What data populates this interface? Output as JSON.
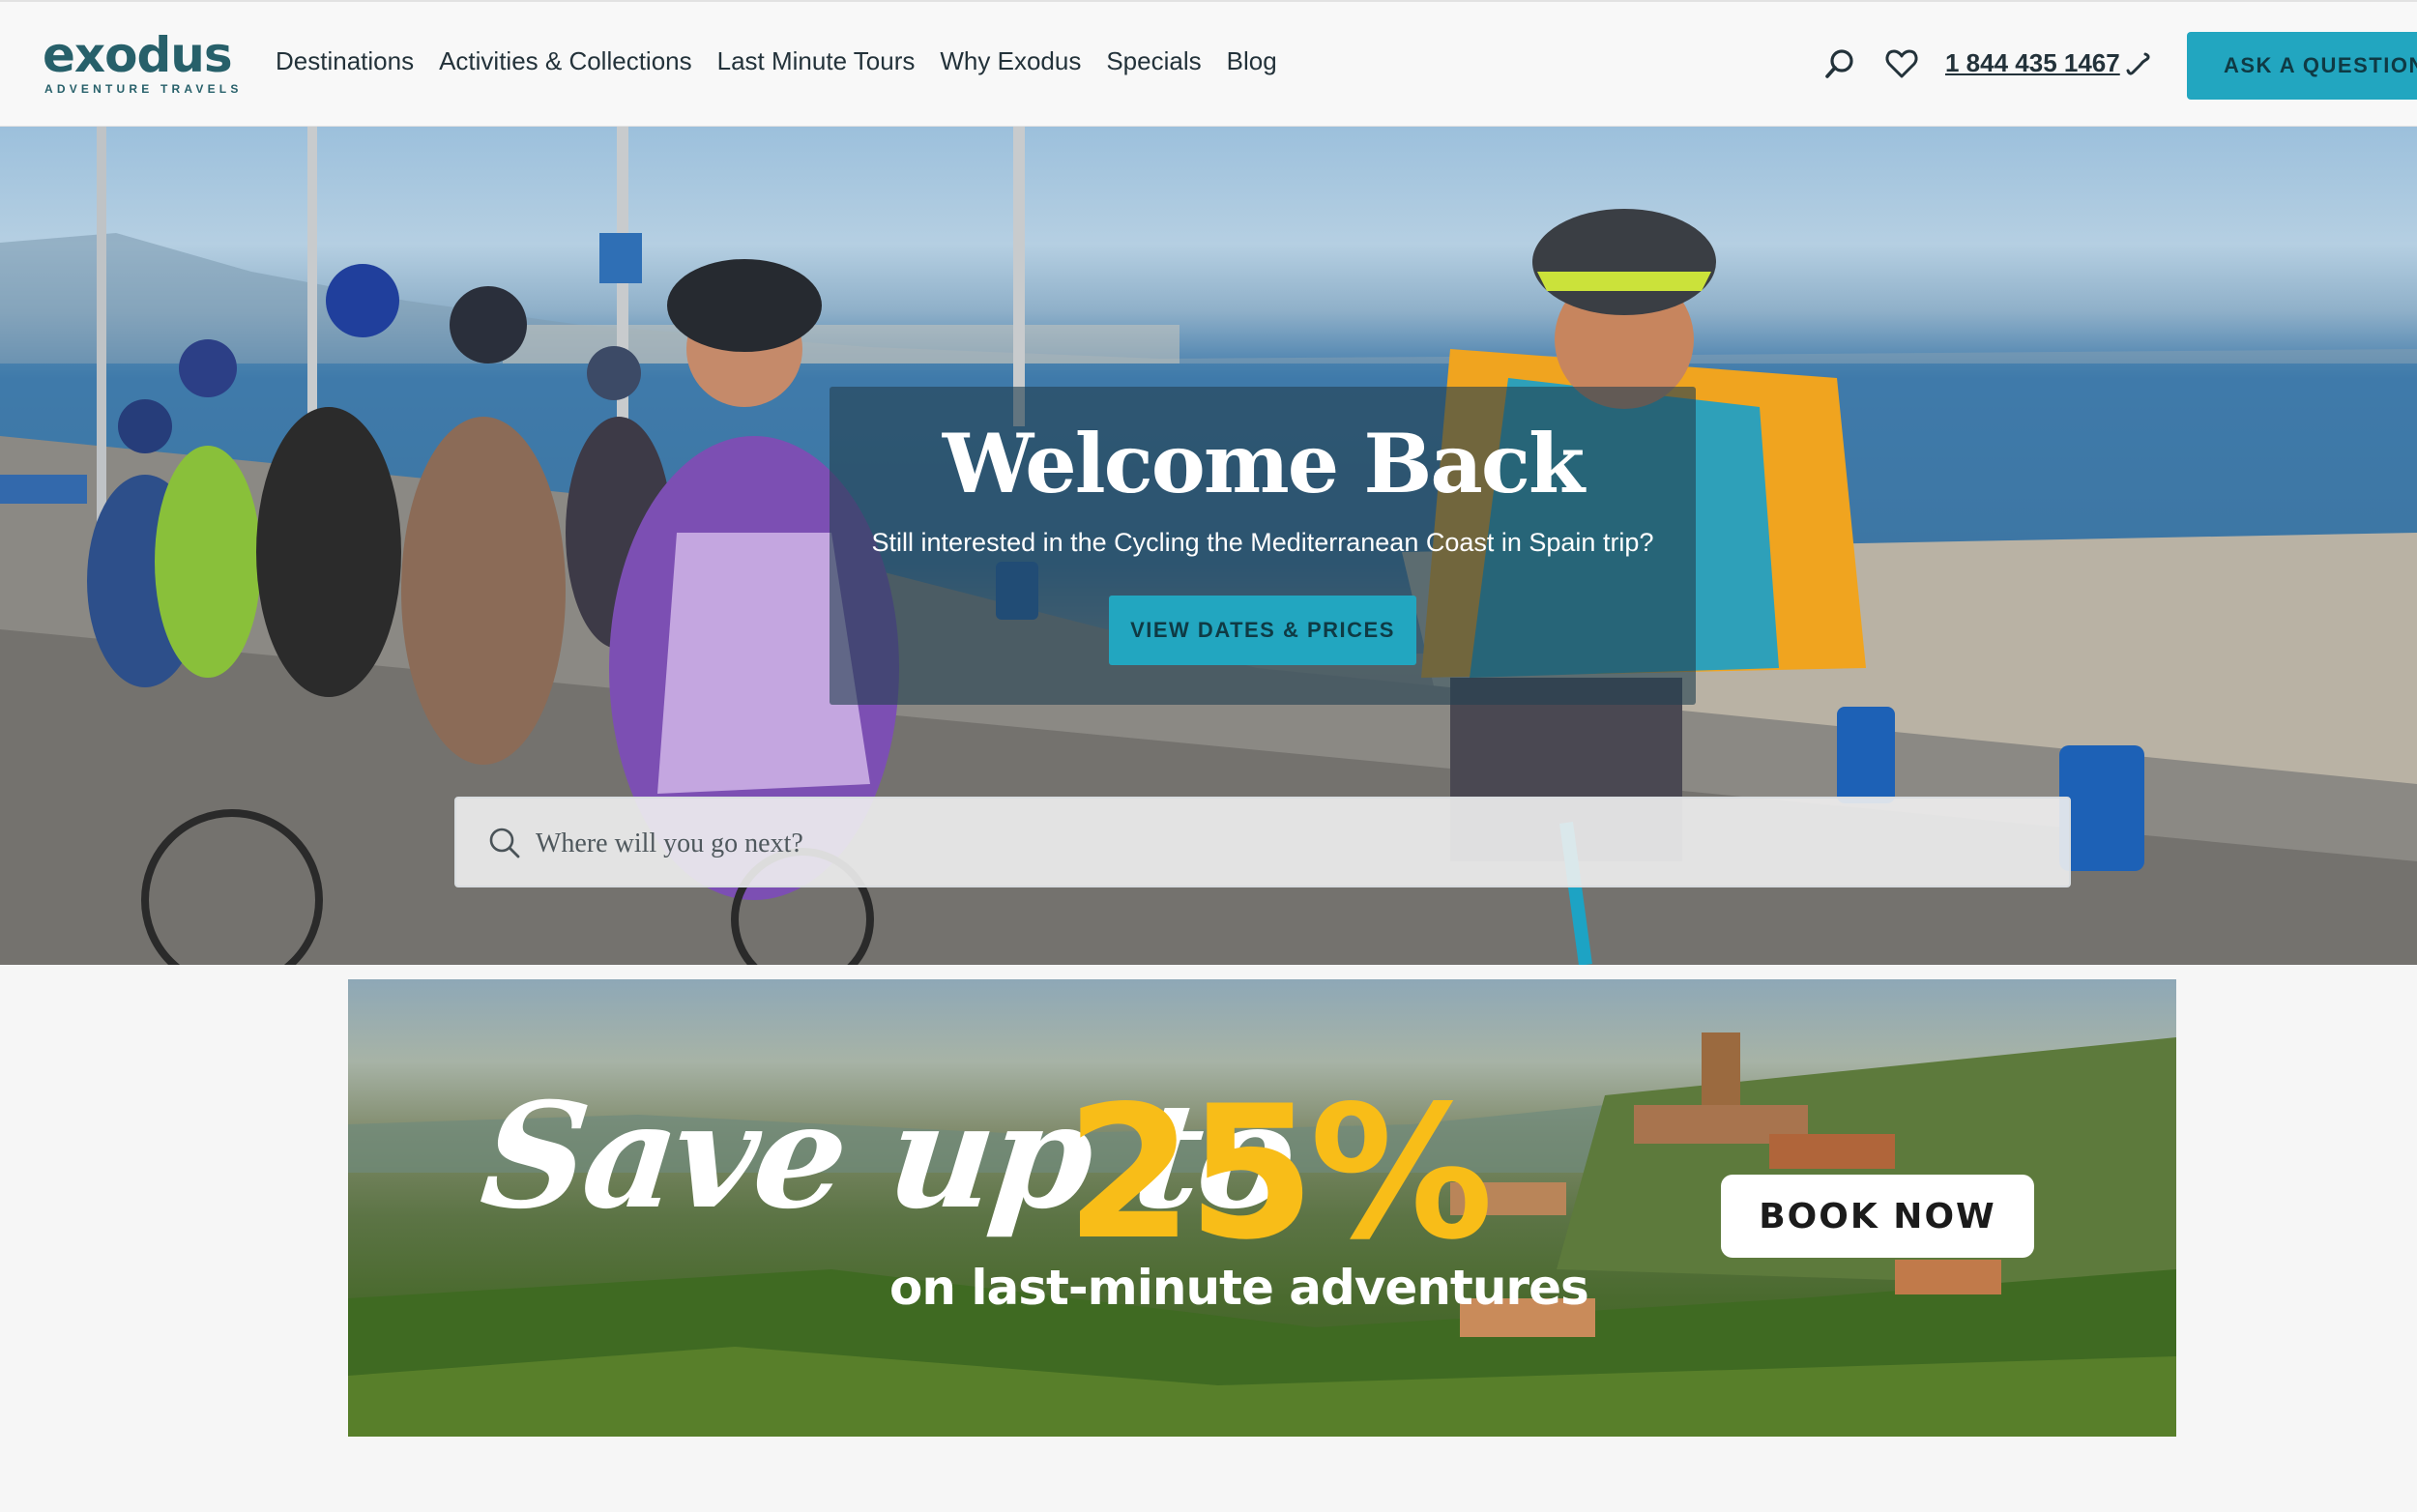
{
  "brand": {
    "name": "exodus",
    "tagline": "ADVENTURE TRAVELS",
    "color": "#27606a",
    "accent": "#22a6c0"
  },
  "nav": [
    {
      "label": "Destinations"
    },
    {
      "label": "Activities & Collections"
    },
    {
      "label": "Last Minute Tours"
    },
    {
      "label": "Why Exodus"
    },
    {
      "label": "Specials"
    },
    {
      "label": "Blog"
    }
  ],
  "header": {
    "search_icon": "search-icon",
    "wishlist_icon": "heart-icon",
    "phone": "1 844 435 1467",
    "phone_icon": "phone-icon",
    "ask_label": "ASK A QUESTION"
  },
  "hero": {
    "title": "Welcome Back",
    "subtitle": "Still interested in the Cycling the Mediterranean Coast in Spain trip?",
    "cta_label": "VIEW DATES & PRICES",
    "search_placeholder": "Where will you go next?"
  },
  "promo": {
    "save_text": "Save up to",
    "percent": "25%",
    "line": "on last-minute adventures",
    "book_label": "BOOK NOW",
    "highlight_color": "#f8bd18"
  }
}
